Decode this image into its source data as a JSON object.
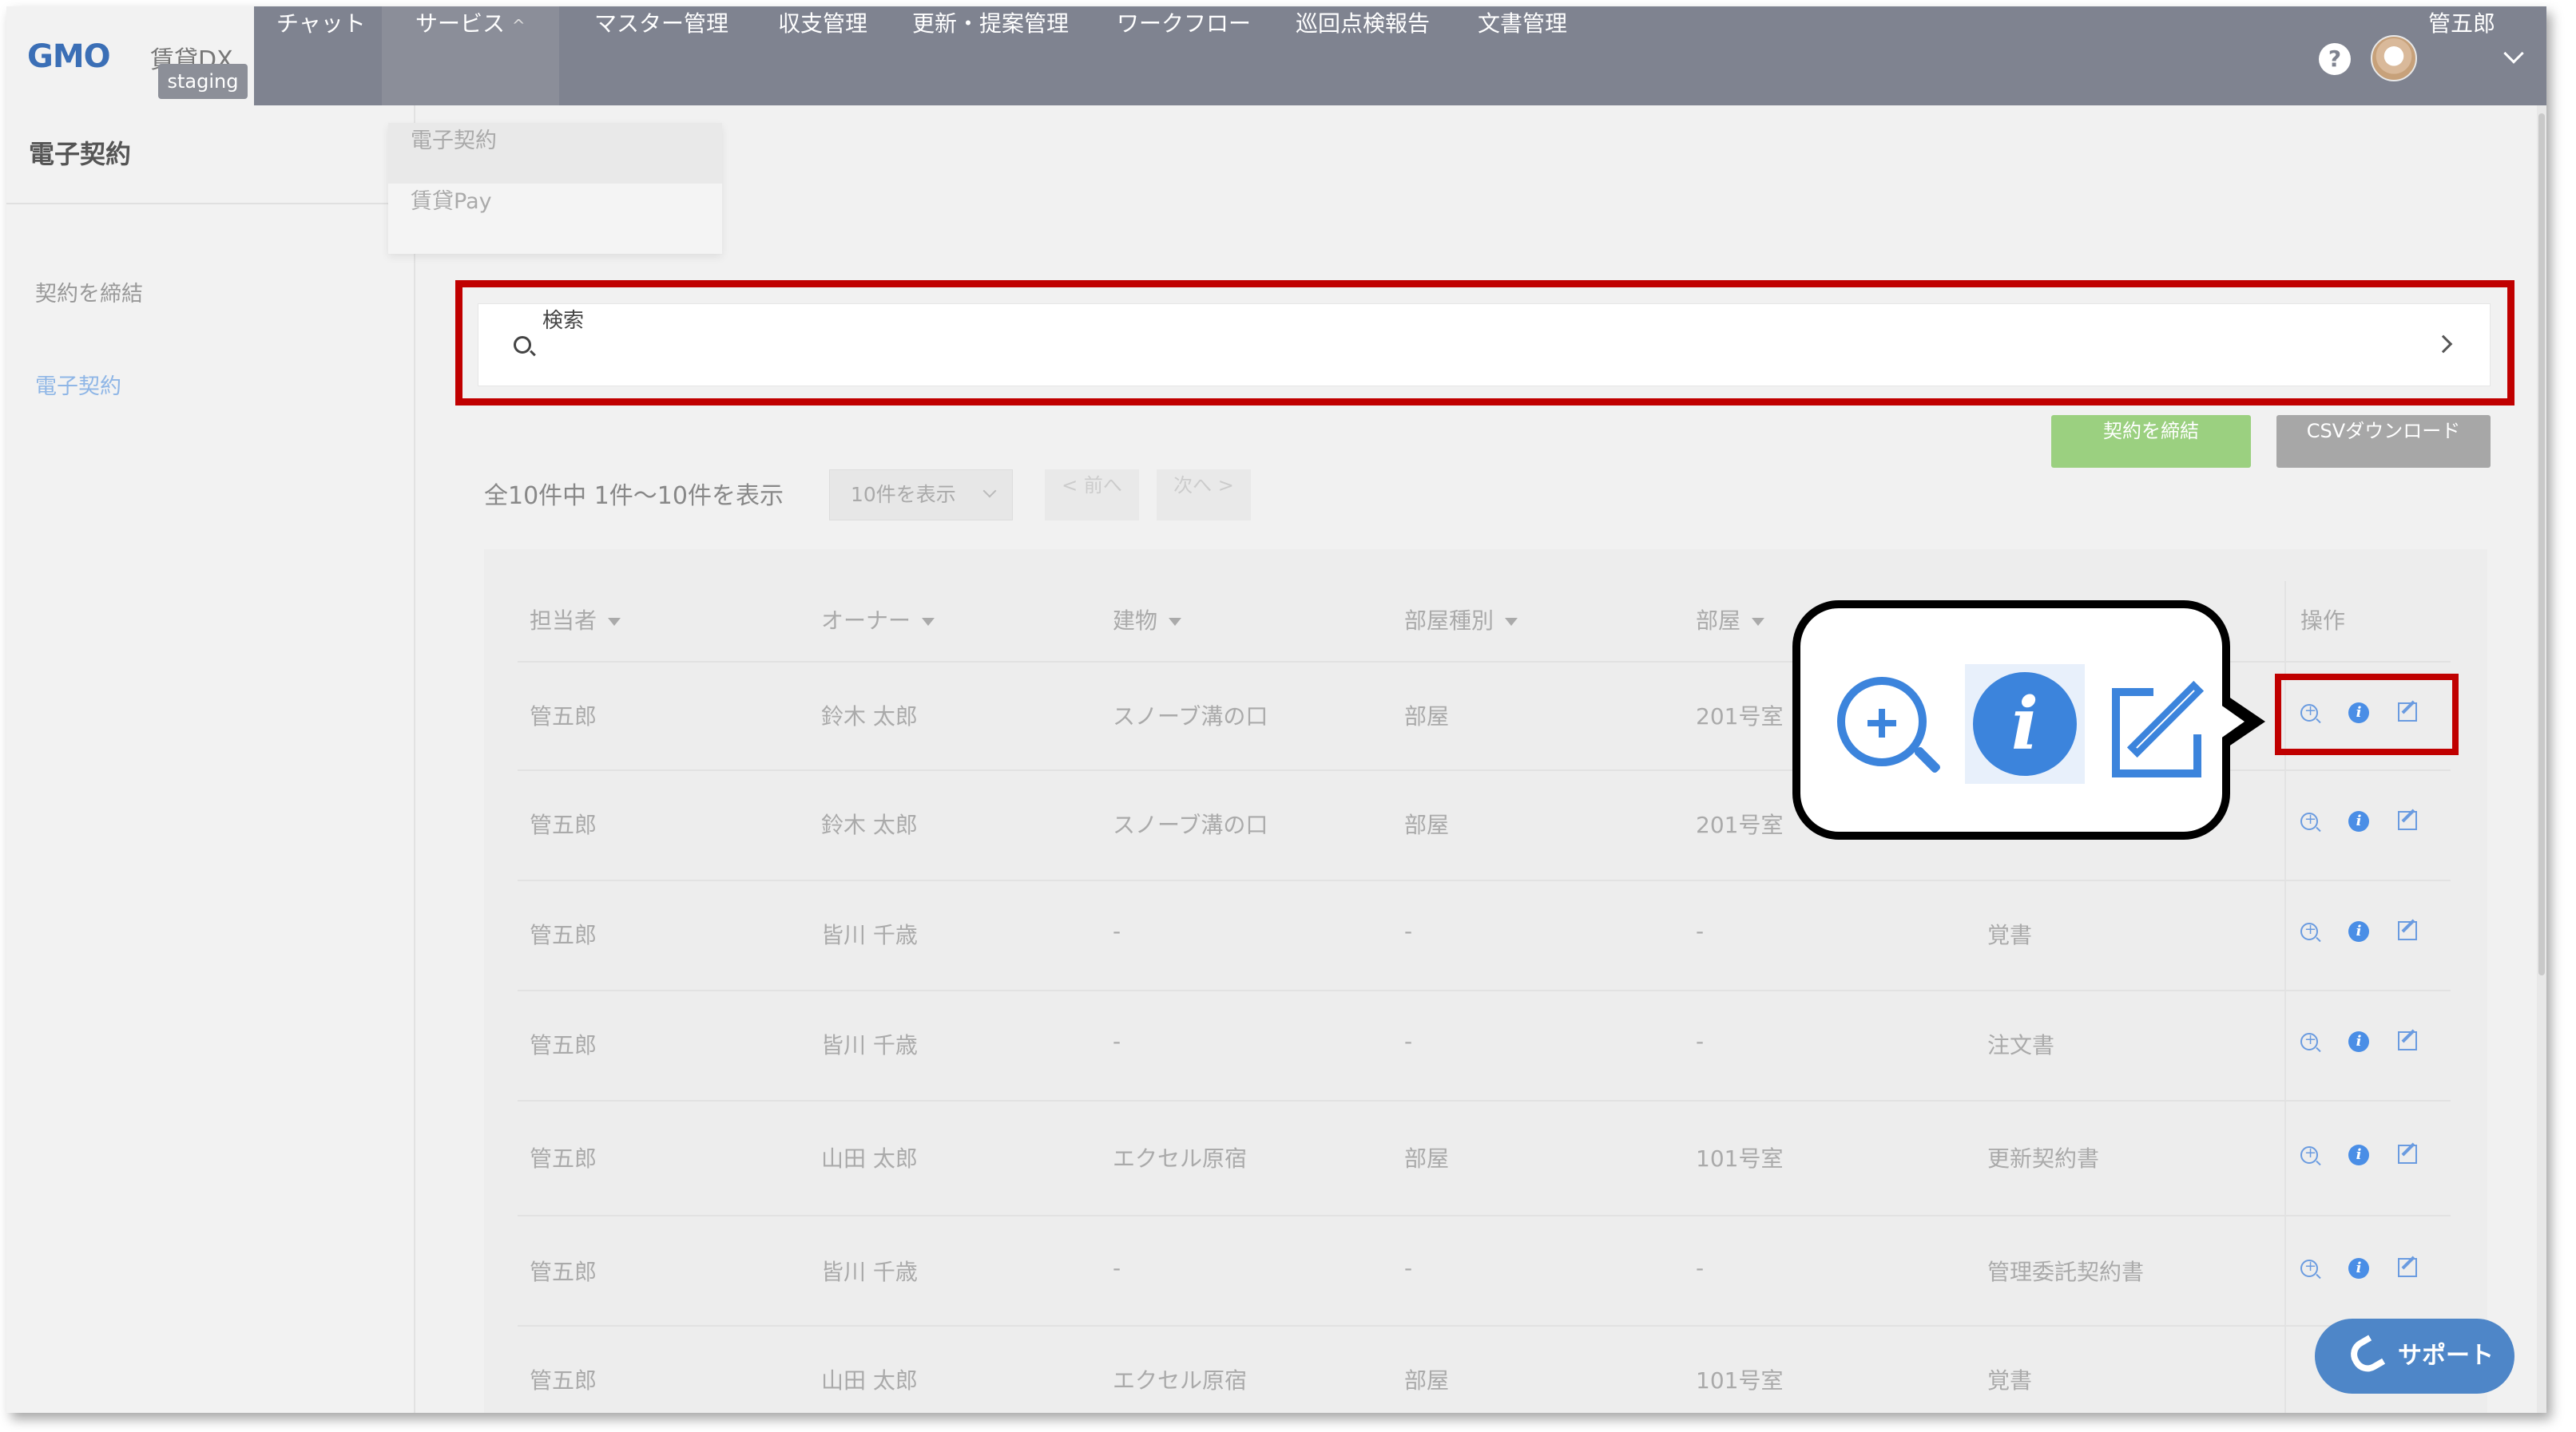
{
  "header": {
    "logo": "GMO",
    "logo_sub": "賃貸DX",
    "env_badge": "staging",
    "nav": [
      {
        "label": "チャット"
      },
      {
        "label": "サービス"
      },
      {
        "label": "マスター管理"
      },
      {
        "label": "収支管理"
      },
      {
        "label": "更新・提案管理"
      },
      {
        "label": "ワークフロー"
      },
      {
        "label": "巡回点検報告"
      },
      {
        "label": "文書管理"
      }
    ],
    "service_caret": "^",
    "help": "?",
    "user_name": "管五郎"
  },
  "service_dropdown": {
    "items": [
      {
        "label": "電子契約"
      },
      {
        "label": "賃貸Pay"
      }
    ]
  },
  "sidebar": {
    "title": "電子契約",
    "items": [
      {
        "label": "契約を締結"
      },
      {
        "label": "電子契約"
      }
    ]
  },
  "search": {
    "placeholder": "検索"
  },
  "actions": {
    "contract_button": "契約を締結",
    "csv_button": "CSVダウンロード"
  },
  "pager": {
    "summary": "全10件中 1件～10件を表示",
    "per_page": "10件を表示",
    "prev": "< 前へ",
    "next": "次へ >"
  },
  "table": {
    "headers": [
      "担当者",
      "オーナー",
      "建物",
      "部屋種別",
      "部屋",
      "操作"
    ],
    "rows": [
      {
        "staff": "管五郎",
        "owner": "鈴木 太郎",
        "building": "スノーブ溝の口",
        "room_type": "部屋",
        "room": "201号室",
        "doc": ""
      },
      {
        "staff": "管五郎",
        "owner": "鈴木 太郎",
        "building": "スノーブ溝の口",
        "room_type": "部屋",
        "room": "201号室",
        "doc": ""
      },
      {
        "staff": "管五郎",
        "owner": "皆川 千歳",
        "building": "-",
        "room_type": "-",
        "room": "-",
        "doc": "覚書"
      },
      {
        "staff": "管五郎",
        "owner": "皆川 千歳",
        "building": "-",
        "room_type": "-",
        "room": "-",
        "doc": "注文書"
      },
      {
        "staff": "管五郎",
        "owner": "山田 太郎",
        "building": "エクセル原宿",
        "room_type": "部屋",
        "room": "101号室",
        "doc": "更新契約書"
      },
      {
        "staff": "管五郎",
        "owner": "皆川 千歳",
        "building": "-",
        "room_type": "-",
        "room": "-",
        "doc": "管理委託契約書"
      },
      {
        "staff": "管五郎",
        "owner": "山田 太郎",
        "building": "エクセル原宿",
        "room_type": "部屋",
        "room": "101号室",
        "doc": "覚書"
      }
    ]
  },
  "callout": {
    "info_glyph": "i"
  },
  "support": {
    "label": "サポート"
  },
  "colors": {
    "header": "#7f8390",
    "highlight": "#c00000",
    "accent": "#3c84dc",
    "green": "#9bd080"
  }
}
